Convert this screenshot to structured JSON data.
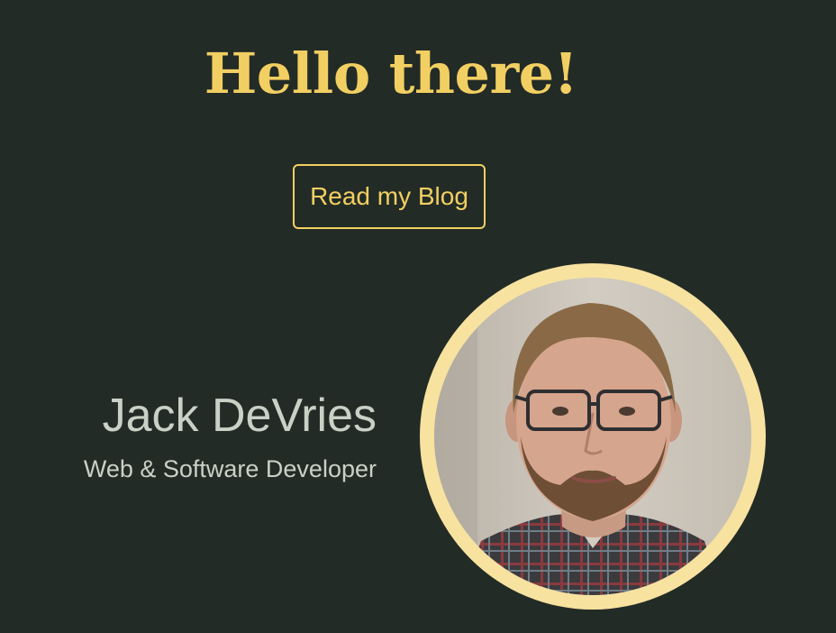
{
  "hero": {
    "greeting": "Hello there!",
    "blog_button_label": "Read my Blog"
  },
  "profile": {
    "name": "Jack DeVries",
    "role": "Web & Software Developer",
    "photo_alt": "Portrait photo of Jack DeVries"
  },
  "colors": {
    "background": "#232b26",
    "accent": "#f2cf62",
    "ring": "#f7e2a0",
    "muted_text": "#c9d1c6"
  }
}
